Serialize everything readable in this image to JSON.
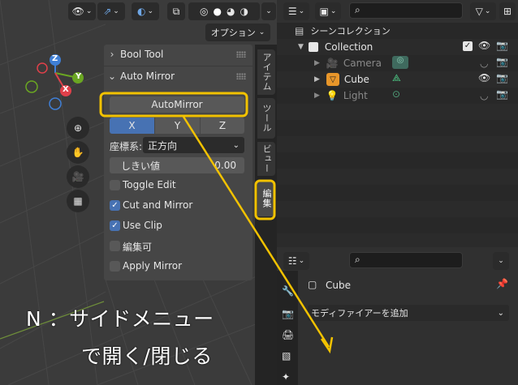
{
  "viewport": {
    "header_dropdown": "オプション",
    "axes": [
      "Z",
      "Y",
      "X"
    ]
  },
  "n_panel": {
    "bool_tool_header": "Bool Tool",
    "auto_mirror_header": "Auto Mirror",
    "automirror_button": "AutoMirror",
    "axis_buttons": [
      "X",
      "Y",
      "Z"
    ],
    "orientation_label": "座標系:",
    "orientation_value": "正方向",
    "threshold_label": "しきい値",
    "threshold_value": "0.00",
    "options": [
      {
        "label": "Toggle Edit",
        "checked": false
      },
      {
        "label": "Cut and Mirror",
        "checked": true
      },
      {
        "label": "Use Clip",
        "checked": true
      },
      {
        "label": "編集可",
        "checked": false
      },
      {
        "label": "Apply Mirror",
        "checked": false
      }
    ]
  },
  "side_tabs": [
    "アイテム",
    "ツール",
    "ビュー",
    "編集"
  ],
  "outliner": {
    "scene_collection": "シーンコレクション",
    "collection": "Collection",
    "items": [
      {
        "name": "Camera",
        "icon": "camera-icon"
      },
      {
        "name": "Cube",
        "icon": "mesh-icon"
      },
      {
        "name": "Light",
        "icon": "light-icon"
      }
    ]
  },
  "properties": {
    "object_name": "Cube",
    "add_modifier": "モディファイアーを追加"
  },
  "annotation": {
    "line1": "N ：サイドメニュー",
    "line2": "で開く/閉じる"
  },
  "colors": {
    "accent_yellow": "#f2c200",
    "selected_blue": "#4772b3",
    "axis_x": "#e0404a",
    "axis_y": "#6aa622",
    "axis_z": "#3f7fd6"
  }
}
